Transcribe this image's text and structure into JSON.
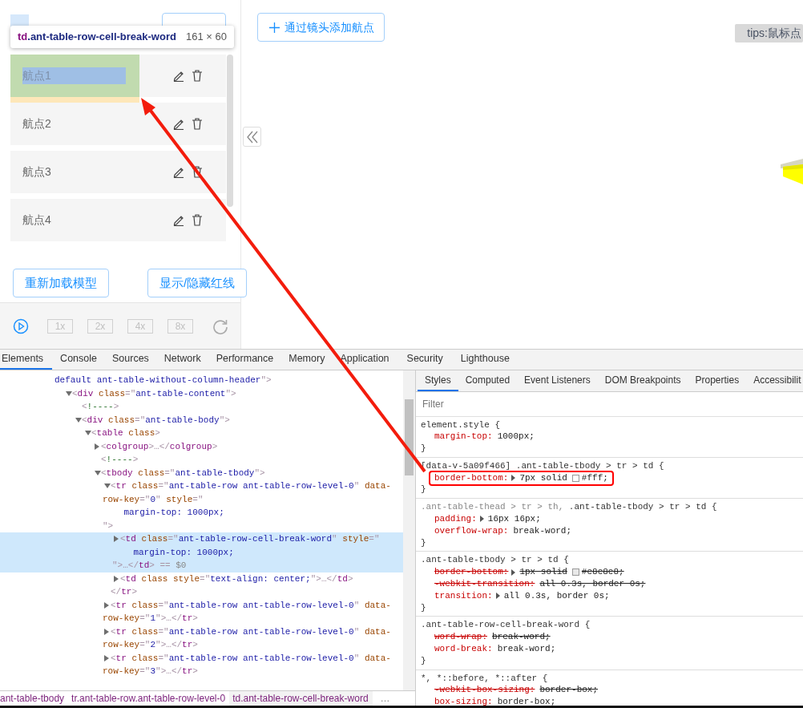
{
  "sidebar": {
    "rows": [
      {
        "label": "航点1",
        "highlighted": true
      },
      {
        "label": "航点2",
        "highlighted": false
      },
      {
        "label": "航点3",
        "highlighted": false
      },
      {
        "label": "航点4",
        "highlighted": false
      }
    ],
    "buttons": [
      "重新加载模型",
      "显示/隐藏红线"
    ],
    "speeds": [
      {
        "label": "1x",
        "disabled": true
      },
      {
        "label": "2x",
        "disabled": true
      },
      {
        "label": "4x",
        "disabled": true
      },
      {
        "label": "8x",
        "disabled": true
      }
    ]
  },
  "inspect_tooltip": {
    "tag": "td",
    "class_name": ".ant-table-row-cell-break-word",
    "size": "161 × 60"
  },
  "viewport": {
    "add_button": "通过镜头添加航点",
    "tip": "tips:鼠标点"
  },
  "devtools": {
    "tabs": [
      {
        "label": "Elements",
        "selected": true
      },
      {
        "label": "Console",
        "selected": false
      },
      {
        "label": "Sources",
        "selected": false
      },
      {
        "label": "Network",
        "selected": false
      },
      {
        "label": "Performance",
        "selected": false
      },
      {
        "label": "Memory",
        "selected": false
      },
      {
        "label": "Application",
        "selected": false
      },
      {
        "label": "Security",
        "selected": false
      },
      {
        "label": "Lighthouse",
        "selected": false
      }
    ],
    "dom_tree": [
      {
        "continued": true,
        "lines": [
          "default ant-table-without-column-header\">"
        ],
        "children": [
          {
            "expanded": true,
            "lines": [
              "<div class=\"ant-table-content\">"
            ],
            "children": [
              {
                "lines": [
                  "<!---->"
                ]
              },
              {
                "expanded": true,
                "lines": [
                  "<div class=\"ant-table-body\">"
                ],
                "children": [
                  {
                    "expanded": true,
                    "lines": [
                      "<table class>"
                    ],
                    "children": [
                      {
                        "expanded": false,
                        "lines": [
                          "<colgroup>…</colgroup>"
                        ]
                      },
                      {
                        "lines": [
                          "<!---->"
                        ]
                      },
                      {
                        "expanded": true,
                        "lines": [
                          "<tbody class=\"ant-table-tbody\">"
                        ],
                        "children": [
                          {
                            "expanded": true,
                            "lines": [
                              "<tr class=\"ant-table-row ant-table-row-level-0\" data-",
                              "row-key=\"0\" style=\"",
                              "    margin-top: 1000px;",
                              "\">"
                            ],
                            "closing": "</tr>",
                            "children": [
                              {
                                "expanded": false,
                                "selected": true,
                                "lines": [
                                  "<td class=\"ant-table-row-cell-break-word\" style=\"",
                                  "    margin-top: 1000px;",
                                  "\">…</td> == $0"
                                ]
                              },
                              {
                                "expanded": false,
                                "selected": false,
                                "lines": [
                                  "<td class style=\"text-align: center;\">…</td>"
                                ]
                              }
                            ]
                          },
                          {
                            "expanded": false,
                            "lines": [
                              "<tr class=\"ant-table-row ant-table-row-level-0\" data-",
                              "row-key=\"1\">…</tr>"
                            ]
                          },
                          {
                            "expanded": false,
                            "lines": [
                              "<tr class=\"ant-table-row ant-table-row-level-0\" data-",
                              "row-key=\"2\">…</tr>"
                            ]
                          },
                          {
                            "expanded": false,
                            "lines": [
                              "<tr class=\"ant-table-row ant-table-row-level-0\" data-",
                              "row-key=\"3\">…</tr>"
                            ]
                          }
                        ]
                      }
                    ]
                  }
                ]
              }
            ]
          }
        ]
      }
    ],
    "breadcrumbs": [
      {
        "label": "ant-table-tbody",
        "selected": false
      },
      {
        "label": "tr.ant-table-row.ant-table-row-level-0",
        "selected": false
      },
      {
        "label": "td.ant-table-row-cell-break-word",
        "selected": true
      }
    ],
    "breadcrumb_more": "…",
    "style_tabs": [
      {
        "label": "Styles",
        "selected": true
      },
      {
        "label": "Computed",
        "selected": false
      },
      {
        "label": "Event Listeners",
        "selected": false
      },
      {
        "label": "DOM Breakpoints",
        "selected": false
      },
      {
        "label": "Properties",
        "selected": false
      },
      {
        "label": "Accessibilit",
        "selected": false
      }
    ],
    "filter_placeholder": "Filter",
    "rules": [
      {
        "selector": [
          {
            "text": "element.style {",
            "matched": true
          }
        ],
        "declarations": [
          {
            "property": "margin-top:",
            "value": "1000px;",
            "expandable": false,
            "overridden": false,
            "highlighted": false
          }
        ],
        "close": "}"
      },
      {
        "selector": [
          {
            "text": "[data-v-5a09f466] .ant-table-tbody > tr > td {",
            "matched": true
          }
        ],
        "declarations": [
          {
            "property": "border-bottom:",
            "value": "7px solid",
            "color": "#ffffff",
            "value_after": "#fff;",
            "expandable": true,
            "overridden": false,
            "highlighted": true
          }
        ],
        "close": "}"
      },
      {
        "selector": [
          {
            "text": ".ant-table-thead > tr > th,",
            "matched": false
          },
          {
            "text": ".ant-table-tbody > tr > td {",
            "matched": true
          }
        ],
        "declarations": [
          {
            "property": "padding:",
            "value": "16px 16px;",
            "expandable": true,
            "overridden": false,
            "highlighted": false
          },
          {
            "property": "overflow-wrap:",
            "value": "break-word;",
            "expandable": false,
            "overridden": false,
            "highlighted": false
          }
        ],
        "close": "}"
      },
      {
        "selector": [
          {
            "text": ".ant-table-tbody > tr > td {",
            "matched": true
          }
        ],
        "declarations": [
          {
            "property": "border-bottom:",
            "value": "1px solid",
            "color": "#e8e8e8",
            "value_after": "#e8e8e8;",
            "expandable": true,
            "overridden": true,
            "highlighted": false
          },
          {
            "property": "-webkit-transition:",
            "value": "all 0.3s, border 0s;",
            "expandable": false,
            "overridden": true,
            "highlighted": false
          },
          {
            "property": "transition:",
            "value": "all 0.3s, border 0s;",
            "expandable": true,
            "overridden": false,
            "highlighted": false
          }
        ],
        "close": "}"
      },
      {
        "selector": [
          {
            "text": ".ant-table-row-cell-break-word {",
            "matched": true
          }
        ],
        "declarations": [
          {
            "property": "word-wrap:",
            "value": "break-word;",
            "expandable": false,
            "overridden": true,
            "highlighted": false
          },
          {
            "property": "word-break:",
            "value": "break-word;",
            "expandable": false,
            "overridden": false,
            "highlighted": false
          }
        ],
        "close": "}"
      },
      {
        "selector": [
          {
            "text": "*, *::before, *::after {",
            "matched": true
          }
        ],
        "declarations": [
          {
            "property": "-webkit-box-sizing:",
            "value": "border-box;",
            "expandable": false,
            "overridden": true,
            "highlighted": false
          },
          {
            "property": "box-sizing:",
            "value": "border-box;",
            "expandable": false,
            "overridden": false,
            "highlighted": false
          }
        ]
      }
    ]
  }
}
